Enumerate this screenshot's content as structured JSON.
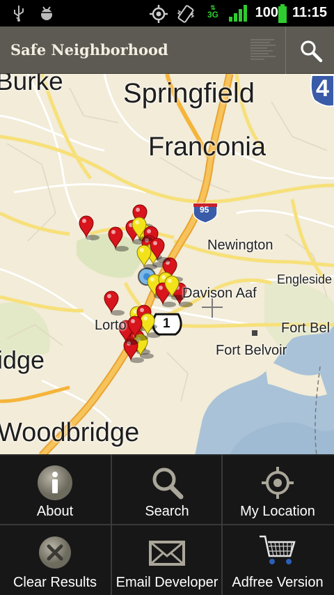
{
  "status_bar": {
    "time": "11:15",
    "battery_level": "100",
    "network_type": "3G",
    "icons": [
      "usb-icon",
      "debug-icon",
      "gps-icon",
      "vibrate-icon",
      "network-icon",
      "signal-icon",
      "battery-icon"
    ]
  },
  "app_bar": {
    "title": "Safe Neighborhood",
    "search_icon": "search-icon"
  },
  "map": {
    "places": {
      "burke": "Burke",
      "springfield": "Springfield",
      "franconia": "Franconia",
      "newington": "Newington",
      "engleside": "Engleside",
      "davison": "Davison Aaf",
      "lorton": "Lorto",
      "fort_bel": "Fort Bel",
      "fort_belvoir": "Fort Belvoir",
      "bridge": "idge",
      "woodbridge": "Woodbridge"
    },
    "shields": {
      "i95": "95",
      "us1": "1",
      "edge": "4"
    },
    "markers": {
      "red": 18,
      "yellow": 9,
      "my_location": 1
    }
  },
  "menu": {
    "items": [
      {
        "label": "About",
        "icon": "info-icon"
      },
      {
        "label": "Search",
        "icon": "search-icon"
      },
      {
        "label": "My Location",
        "icon": "crosshair-icon"
      },
      {
        "label": "Clear Results",
        "icon": "clear-icon"
      },
      {
        "label": "Email Developer",
        "icon": "email-icon"
      },
      {
        "label": "Adfree Version",
        "icon": "cart-icon"
      }
    ]
  },
  "colors": {
    "title_bar": "#5c5a52",
    "map_land": "#f2ecd8",
    "highway": "#f5b43a",
    "water": "#a9c2d8",
    "marker_red": "#d8141c",
    "marker_yellow": "#f2e21a",
    "menu_bg": "#191919"
  }
}
